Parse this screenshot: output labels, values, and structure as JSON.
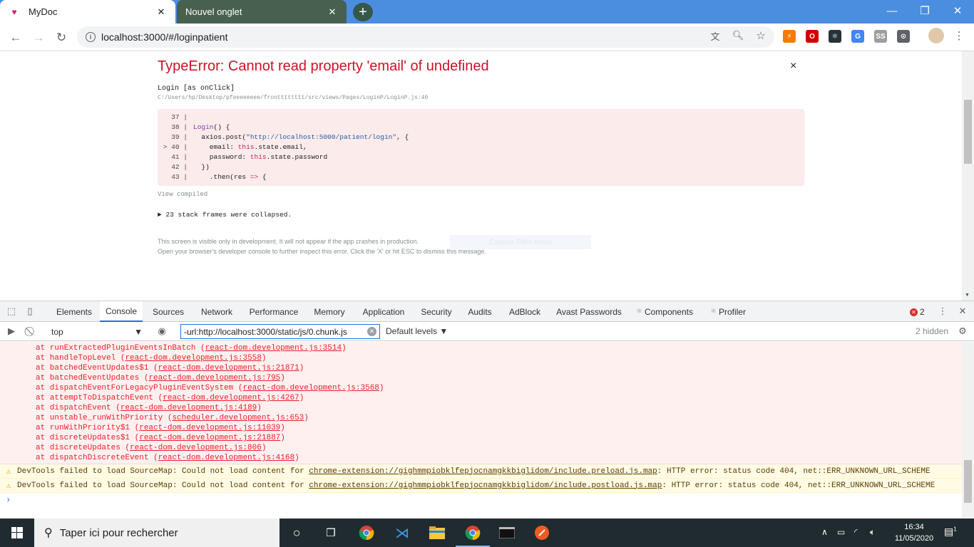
{
  "browser": {
    "tabs": [
      {
        "title": "MyDoc",
        "active": true
      },
      {
        "title": "Nouvel onglet",
        "active": false
      }
    ],
    "new_tab_label": "+",
    "url": "localhost:3000/#/loginpatient",
    "window_buttons": {
      "minimize": "—",
      "restore": "❐",
      "close": "✕"
    },
    "extensions": [
      {
        "name": "ext-fire-icon",
        "color": "#f57c00",
        "glyph": "⚡"
      },
      {
        "name": "ext-opera-icon",
        "color": "#d50000",
        "glyph": "O"
      },
      {
        "name": "ext-react-icon",
        "color": "#263238",
        "glyph": "⚛"
      },
      {
        "name": "ext-translate-icon",
        "color": "#4285f4",
        "glyph": "G"
      },
      {
        "name": "ext-ss-icon",
        "color": "#9e9e9e",
        "glyph": "SS"
      },
      {
        "name": "ext-circle-icon",
        "color": "#5f6368",
        "glyph": "⊙"
      }
    ]
  },
  "error_overlay": {
    "title": "TypeError: Cannot read property 'email' of undefined",
    "close": "×",
    "function": "Login [as onClick]",
    "path": "C:/Users/hp/Desktop/pfeeeeeeee/frontttttttt/src/views/Pages/LoginP/LoginP.js:40",
    "code_lines": [
      {
        "gutter": "37 |",
        "parts": [
          {
            "t": "",
            "c": ""
          }
        ]
      },
      {
        "gutter": "38 |",
        "parts": [
          {
            "t": "Login",
            "c": "mg"
          },
          {
            "t": "() {",
            "c": ""
          }
        ]
      },
      {
        "gutter": "39 |",
        "parts": [
          {
            "t": "  axios.post(",
            "c": ""
          },
          {
            "t": "\"http://localhost:5000/patient/login\"",
            "c": "str"
          },
          {
            "t": ", {",
            "c": ""
          }
        ]
      },
      {
        "gutter": "> 40 |",
        "parts": [
          {
            "t": "    email: ",
            "c": ""
          },
          {
            "t": "this",
            "c": "kw"
          },
          {
            "t": ".state.email,",
            "c": ""
          }
        ]
      },
      {
        "gutter": "41 |",
        "parts": [
          {
            "t": "    password: ",
            "c": ""
          },
          {
            "t": "this",
            "c": "kw"
          },
          {
            "t": ".state.password",
            "c": ""
          }
        ]
      },
      {
        "gutter": "42 |",
        "parts": [
          {
            "t": "  })",
            "c": ""
          }
        ]
      },
      {
        "gutter": "43 |",
        "parts": [
          {
            "t": "    .then(res ",
            "c": ""
          },
          {
            "t": "=>",
            "c": "kw"
          },
          {
            "t": " {",
            "c": ""
          }
        ]
      }
    ],
    "view_compiled": "View compiled",
    "collapsed": "► 23 stack frames were collapsed.",
    "note_line1": "This screen is visible only in development. It will not appear if the app crashes in production.",
    "note_line2": "Open your browser's developer console to further inspect this error.  Click the 'X' or hit ESC to dismiss this message.",
    "capture_label": "Capture Plein écran"
  },
  "devtools": {
    "tabs": [
      "Elements",
      "Console",
      "Sources",
      "Network",
      "Performance",
      "Memory",
      "Application",
      "Security",
      "Audits",
      "AdBlock",
      "Avast Passwords",
      "Components",
      "Profiler"
    ],
    "selected_tab": "Console",
    "error_count": "2",
    "context": "top",
    "filter_value": "-url:http://localhost:3000/static/js/0.chunk.js",
    "levels": "Default levels ▼",
    "hidden": "2 hidden",
    "stack": [
      {
        "fn": "at runExtractedPluginEventsInBatch ",
        "loc": "react-dom.development.js:3514"
      },
      {
        "fn": "at handleTopLevel ",
        "loc": "react-dom.development.js:3558"
      },
      {
        "fn": "at batchedEventUpdates$1 ",
        "loc": "react-dom.development.js:21871"
      },
      {
        "fn": "at batchedEventUpdates ",
        "loc": "react-dom.development.js:795"
      },
      {
        "fn": "at dispatchEventForLegacyPluginEventSystem ",
        "loc": "react-dom.development.js:3568"
      },
      {
        "fn": "at attemptToDispatchEvent ",
        "loc": "react-dom.development.js:4267"
      },
      {
        "fn": "at dispatchEvent ",
        "loc": "react-dom.development.js:4189"
      },
      {
        "fn": "at unstable_runWithPriority ",
        "loc": "scheduler.development.js:653"
      },
      {
        "fn": "at runWithPriority$1 ",
        "loc": "react-dom.development.js:11039"
      },
      {
        "fn": "at discreteUpdates$1 ",
        "loc": "react-dom.development.js:21887"
      },
      {
        "fn": "at discreteUpdates ",
        "loc": "react-dom.development.js:806"
      },
      {
        "fn": "at dispatchDiscreteEvent ",
        "loc": "react-dom.development.js:4168"
      }
    ],
    "warnings": [
      {
        "pre": "DevTools failed to load SourceMap: Could not load content for ",
        "link": "chrome-extension://gighmmpiobklfepjocnamgkkbiglidom/include.preload.js.map",
        "post": ": HTTP error: status code 404, net::ERR_UNKNOWN_URL_SCHEME"
      },
      {
        "pre": "DevTools failed to load SourceMap: Could not load content for ",
        "link": "chrome-extension://gighmmpiobklfepjocnamgkkbiglidom/include.postload.js.map",
        "post": ": HTTP error: status code 404, net::ERR_UNKNOWN_URL_SCHEME"
      }
    ],
    "prompt": "›"
  },
  "taskbar": {
    "search_placeholder": "Taper ici pour rechercher",
    "time": "16:34",
    "date": "11/05/2020",
    "notification_count": "1"
  }
}
